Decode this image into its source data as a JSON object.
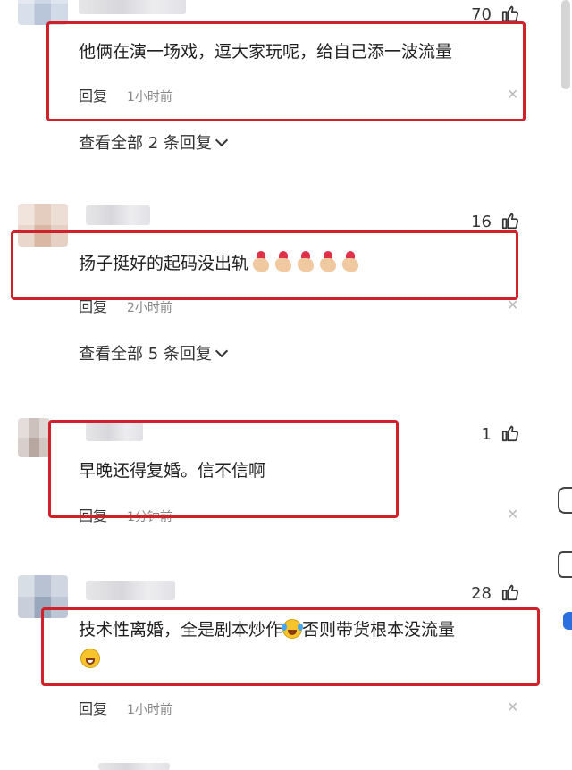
{
  "comments": [
    {
      "likes": "70",
      "text": "他俩在演一场戏，逗大家玩呢，给自己添一波流量",
      "reply_label": "回复",
      "time": "1小时前",
      "view_all": "查看全部 2 条回复"
    },
    {
      "likes": "16",
      "text": "扬子挺好的起码没出轨",
      "reply_label": "回复",
      "time": "2小时前",
      "view_all": "查看全部 5 条回复"
    },
    {
      "likes": "1",
      "text": "早晚还得复婚。信不信啊",
      "reply_label": "回复",
      "time": "1分钟前"
    },
    {
      "likes": "28",
      "text_part1": "技术性离婚，全是剧本炒作",
      "text_part2": "否则带货根本没流量",
      "reply_label": "回复",
      "time": "1小时前"
    }
  ],
  "icons": {
    "like": "thumbs-up-icon",
    "close": "close-icon",
    "expand": "chevron-down-icon",
    "emoji_heart_hand": "finger-heart-emoji",
    "emoji_laugh_cry": "laughing-crying-emoji",
    "emoji_grin": "grinning-face-emoji"
  },
  "colors": {
    "highlight_box": "#d0202a",
    "time_text": "#888888",
    "close_icon": "#bbbbbb"
  }
}
